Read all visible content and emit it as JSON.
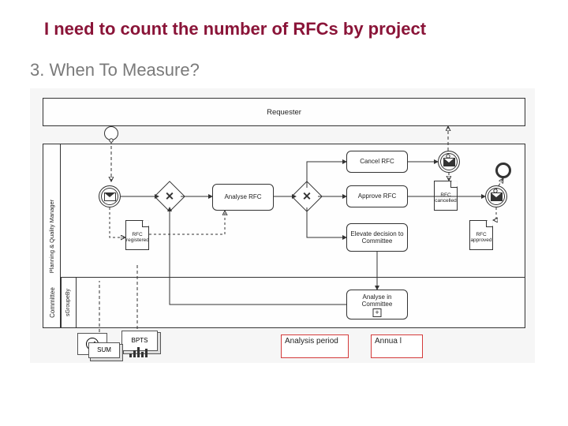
{
  "title": "I need to count the number of RFCs by project",
  "subtitle": "3. When To Measure?",
  "pool_requester": "Requester",
  "lane_pq": "Planning & Quality Manager",
  "lane_committee": "Committee",
  "lane_sub": "sGroupeBy",
  "tasks": {
    "analyse_rfc": "Analyse RFC",
    "cancel_rfc": "Cancel RFC",
    "approve_rfc": "Approve RFC",
    "elevate": "Elevate decision to Committee",
    "analyse_committee": "Analyse in\nCommittee"
  },
  "docs": {
    "rfc_registered": "RFC\nregistered",
    "rfc_cancelled": "RFC\ncancelled",
    "rfc_approved": "RFC\napproved"
  },
  "bottom": {
    "bpts": "BPTS",
    "sum": "SUM",
    "analysis_period": "Analysis period",
    "annual": "Annua l"
  }
}
